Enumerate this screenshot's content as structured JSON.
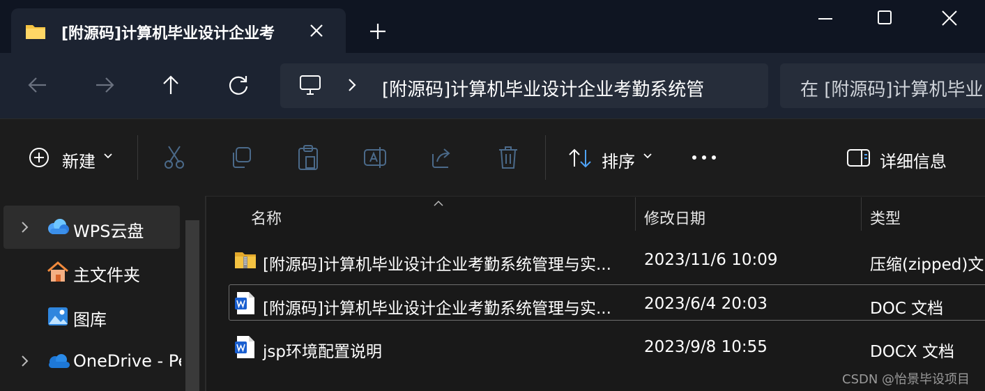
{
  "tab": {
    "title": "[附源码]计算机毕业设计企业考"
  },
  "address": {
    "path": "[附源码]计算机毕业设计企业考勤系统管",
    "search_placeholder": "在 [附源码]计算机毕业"
  },
  "toolbar": {
    "new_label": "新建",
    "sort_label": "排序",
    "details_label": "详细信息"
  },
  "sidebar": {
    "items": [
      {
        "label": "WPS云盘",
        "expandable": true,
        "selected": true
      },
      {
        "label": "主文件夹",
        "expandable": false
      },
      {
        "label": "图库",
        "expandable": false
      },
      {
        "label": "OneDrive - Pe",
        "expandable": true
      }
    ]
  },
  "columns": {
    "name": "名称",
    "modified": "修改日期",
    "type": "类型"
  },
  "files": [
    {
      "name": "[附源码]计算机毕业设计企业考勤系统管理与实...",
      "modified": "2023/11/6 10:09",
      "type": "压缩(zipped)文",
      "icon": "zip-folder-icon"
    },
    {
      "name": "[附源码]计算机毕业设计企业考勤系统管理与实...",
      "modified": "2023/6/4 20:03",
      "type": "DOC 文档",
      "icon": "word-doc-icon"
    },
    {
      "name": "jsp环境配置说明",
      "modified": "2023/9/8 10:55",
      "type": "DOCX 文档",
      "icon": "word-doc-icon"
    }
  ],
  "watermark": "CSDN @怡景毕设项目",
  "colors": {
    "accent": "#4fa3f7",
    "folder": "#f4c342",
    "titlebar": "#0f1522",
    "navbar": "#1c2331"
  }
}
